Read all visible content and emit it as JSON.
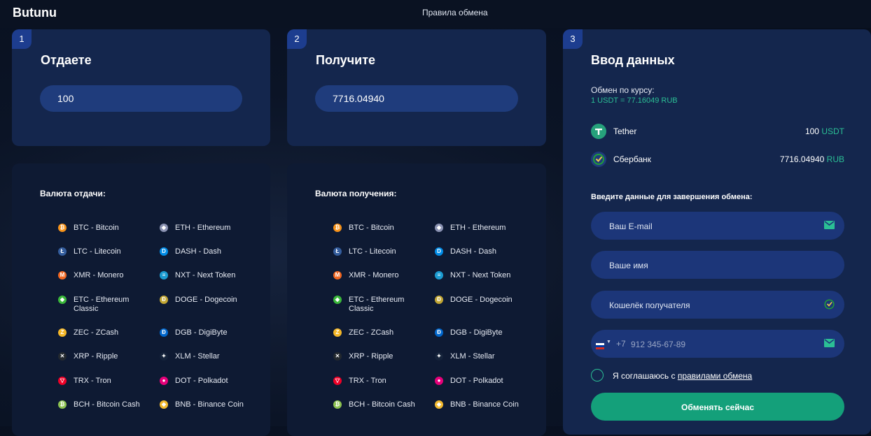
{
  "header": {
    "logo": "Butunu",
    "nav_rules": "Правила обмена"
  },
  "give": {
    "step": "1",
    "title": "Отдаете",
    "amount": "100"
  },
  "receive": {
    "step": "2",
    "title": "Получите",
    "amount": "7716.04940"
  },
  "details": {
    "step": "3",
    "title": "Ввод данных",
    "rate_label": "Обмен по курсу:",
    "rate_value": "1 USDT = 77.16049 RUB",
    "from": {
      "name": "Tether",
      "amount": "100",
      "unit": "USDT"
    },
    "to": {
      "name": "Сбербанк",
      "amount": "7716.04940",
      "unit": "RUB"
    },
    "form_title": "Введите данные для завершения обмена:",
    "email_placeholder": "Ваш E-mail",
    "name_placeholder": "Ваше имя",
    "wallet_placeholder": "Кошелёк получателя",
    "phone_code": "+7",
    "phone_placeholder": "912 345-67-89",
    "agree_text": "Я соглашаюсь с ",
    "agree_link": "правилами обмена",
    "submit_label": "Обменять сейчас"
  },
  "give_list": {
    "title": "Валюта отдачи:",
    "left": [
      {
        "label": "BTC - Bitcoin",
        "icon": "bitcoin-icon",
        "color": "#f7931a"
      },
      {
        "label": "LTC - Litecoin",
        "icon": "litecoin-icon",
        "color": "#345d9d"
      },
      {
        "label": "XMR - Monero",
        "icon": "monero-icon",
        "color": "#f26822"
      },
      {
        "label": "ETC - Ethereum Classic",
        "icon": "ethereum-classic-icon",
        "color": "#3ab83a"
      },
      {
        "label": "ZEC - ZCash",
        "icon": "zcash-icon",
        "color": "#f4b728"
      },
      {
        "label": "XRP - Ripple",
        "icon": "ripple-icon",
        "color": "#23292f"
      },
      {
        "label": "TRX - Tron",
        "icon": "tron-icon",
        "color": "#ef0027"
      },
      {
        "label": "BCH - Bitcoin Cash",
        "icon": "bitcoin-cash-icon",
        "color": "#8dc351"
      }
    ],
    "right": [
      {
        "label": "ETH - Ethereum",
        "icon": "ethereum-icon",
        "color": "#8a92b2"
      },
      {
        "label": "DASH - Dash",
        "icon": "dash-icon",
        "color": "#008ce7"
      },
      {
        "label": "NXT - Next Token",
        "icon": "nxt-icon",
        "color": "#1b9bd1"
      },
      {
        "label": "DOGE - Dogecoin",
        "icon": "dogecoin-icon",
        "color": "#c2a633"
      },
      {
        "label": "DGB - DigiByte",
        "icon": "digibyte-icon",
        "color": "#0066cc"
      },
      {
        "label": "XLM - Stellar",
        "icon": "stellar-icon",
        "color": "#14223a"
      },
      {
        "label": "DOT - Polkadot",
        "icon": "polkadot-icon",
        "color": "#e6007a"
      },
      {
        "label": "BNB - Binance Coin",
        "icon": "binance-icon",
        "color": "#f3ba2f"
      }
    ]
  },
  "receive_list": {
    "title": "Валюта получения:",
    "left": [
      {
        "label": "BTC - Bitcoin",
        "icon": "bitcoin-icon",
        "color": "#f7931a"
      },
      {
        "label": "LTC - Litecoin",
        "icon": "litecoin-icon",
        "color": "#345d9d"
      },
      {
        "label": "XMR - Monero",
        "icon": "monero-icon",
        "color": "#f26822"
      },
      {
        "label": "ETC - Ethereum Classic",
        "icon": "ethereum-classic-icon",
        "color": "#3ab83a"
      },
      {
        "label": "ZEC - ZCash",
        "icon": "zcash-icon",
        "color": "#f4b728"
      },
      {
        "label": "XRP - Ripple",
        "icon": "ripple-icon",
        "color": "#23292f"
      },
      {
        "label": "TRX - Tron",
        "icon": "tron-icon",
        "color": "#ef0027"
      },
      {
        "label": "BCH - Bitcoin Cash",
        "icon": "bitcoin-cash-icon",
        "color": "#8dc351"
      }
    ],
    "right": [
      {
        "label": "ETH - Ethereum",
        "icon": "ethereum-icon",
        "color": "#8a92b2"
      },
      {
        "label": "DASH - Dash",
        "icon": "dash-icon",
        "color": "#008ce7"
      },
      {
        "label": "NXT - Next Token",
        "icon": "nxt-icon",
        "color": "#1b9bd1"
      },
      {
        "label": "DOGE - Dogecoin",
        "icon": "dogecoin-icon",
        "color": "#c2a633"
      },
      {
        "label": "DGB - DigiByte",
        "icon": "digibyte-icon",
        "color": "#0066cc"
      },
      {
        "label": "XLM - Stellar",
        "icon": "stellar-icon",
        "color": "#14223a"
      },
      {
        "label": "DOT - Polkadot",
        "icon": "polkadot-icon",
        "color": "#e6007a"
      },
      {
        "label": "BNB - Binance Coin",
        "icon": "binance-icon",
        "color": "#f3ba2f"
      }
    ]
  },
  "colors": {
    "accent": "#14a07a",
    "card": "#14264d",
    "field": "#1c3679"
  }
}
